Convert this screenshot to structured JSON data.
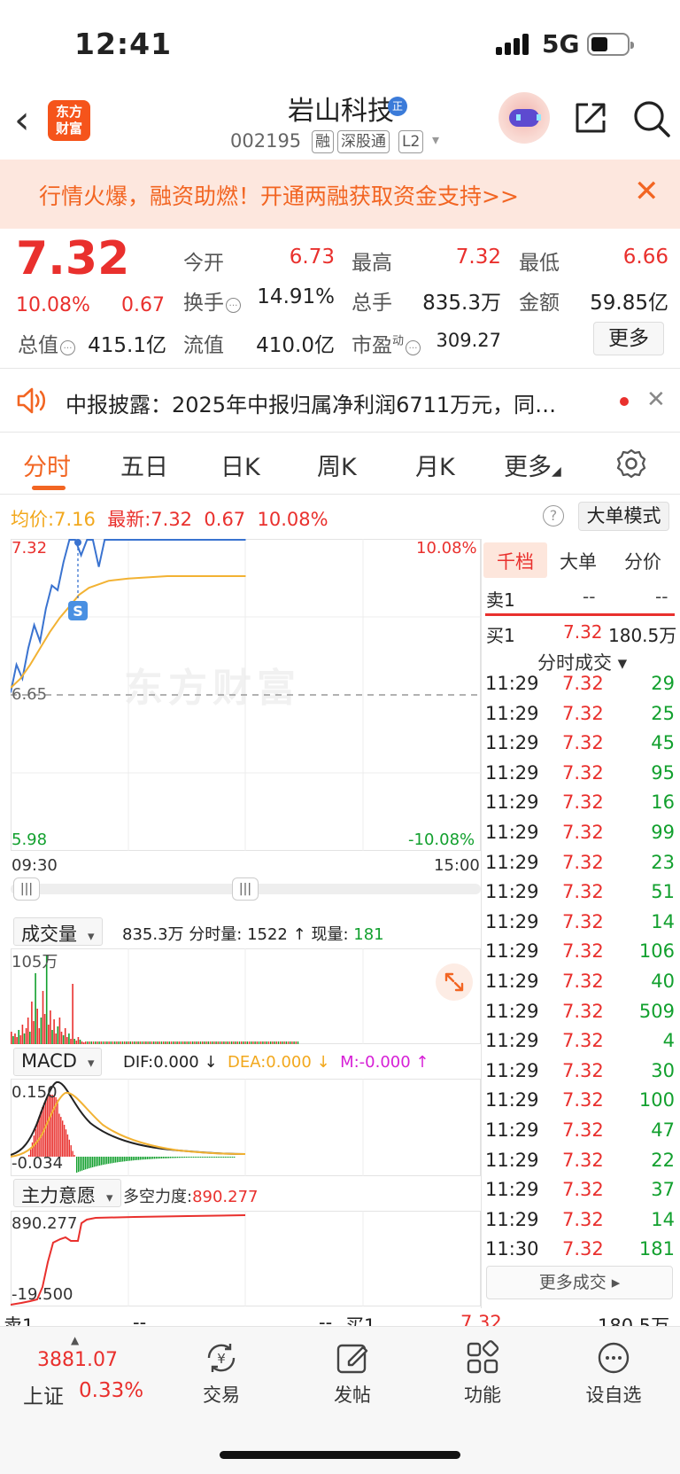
{
  "status_bar": {
    "time": "12:41",
    "network": "5G"
  },
  "header": {
    "stock_name": "岩山科技",
    "badge": "正",
    "code": "002195",
    "tags": [
      "融",
      "深股通",
      "L2"
    ],
    "logo_text": "东方财富",
    "icons": [
      "back-icon",
      "robot-avatar-icon",
      "share-icon",
      "search-icon"
    ]
  },
  "promo": {
    "text": "行情火爆，融资助燃！开通两融获取资金支持>>",
    "close": "✕"
  },
  "quote": {
    "price": "7.32",
    "change_pct": "10.08%",
    "change": "0.67",
    "open_label": "今开",
    "open": "6.73",
    "high_label": "最高",
    "high": "7.32",
    "low_label": "最低",
    "low": "6.66",
    "turnover_label": "换手",
    "turnover": "14.91%",
    "volume_label": "总手",
    "volume": "835.3万",
    "amount_label": "金额",
    "amount": "59.85亿",
    "mcap_label": "总值",
    "mcap": "415.1亿",
    "float_label": "流值",
    "float": "410.0亿",
    "pe_label": "市盈",
    "pe_sup": "动",
    "pe": "309.27",
    "more": "更多"
  },
  "news": {
    "text": "中报披露：2025年中报归属净利润6711万元，同…",
    "close": "✕"
  },
  "tabs": {
    "items": [
      "分时",
      "五日",
      "日K",
      "周K",
      "月K",
      "更多"
    ],
    "active": 0
  },
  "chart_info": {
    "avg_label": "均价:",
    "avg": "7.16",
    "latest_label": "最新:",
    "latest": "7.32",
    "chg": "0.67",
    "pct": "10.08%",
    "big_mode": "大单模式",
    "help": "?"
  },
  "chart": {
    "y_top": "7.32",
    "y_mid": "6.65",
    "y_bottom": "5.98",
    "pct_top": "10.08%",
    "pct_bottom": "-10.08%",
    "x_start": "09:30",
    "x_end": "15:00",
    "watermark": "东方财富",
    "marker": "S"
  },
  "volume_panel": {
    "selector": "成交量",
    "total": "835.3万",
    "minute_label": "分时量:",
    "minute": "1522",
    "arrow": "↑",
    "now_label": "现量:",
    "now": "181",
    "scale": "105万"
  },
  "macd_panel": {
    "selector": "MACD",
    "dif": "DIF:0.000 ↓",
    "dea": "DEA:0.000 ↓",
    "m": "M:-0.000 ↑",
    "top": "0.150",
    "bottom": "-0.034"
  },
  "force_panel": {
    "selector": "主力意愿",
    "label": "多空力度:",
    "value": "890.277",
    "top": "890.277",
    "bottom": "-19.500"
  },
  "right_panel": {
    "tabs": [
      "千档",
      "大单",
      "分价"
    ],
    "sell1": {
      "label": "卖1",
      "price": "--",
      "vol": "--"
    },
    "buy1": {
      "label": "买1",
      "price": "7.32",
      "vol": "180.5万"
    },
    "ticks_header": "分时成交 ▾",
    "ticks": [
      {
        "t": "11:29",
        "p": "7.32",
        "v": "29"
      },
      {
        "t": "11:29",
        "p": "7.32",
        "v": "25"
      },
      {
        "t": "11:29",
        "p": "7.32",
        "v": "45"
      },
      {
        "t": "11:29",
        "p": "7.32",
        "v": "95"
      },
      {
        "t": "11:29",
        "p": "7.32",
        "v": "16"
      },
      {
        "t": "11:29",
        "p": "7.32",
        "v": "99"
      },
      {
        "t": "11:29",
        "p": "7.32",
        "v": "23"
      },
      {
        "t": "11:29",
        "p": "7.32",
        "v": "51"
      },
      {
        "t": "11:29",
        "p": "7.32",
        "v": "14"
      },
      {
        "t": "11:29",
        "p": "7.32",
        "v": "106"
      },
      {
        "t": "11:29",
        "p": "7.32",
        "v": "40"
      },
      {
        "t": "11:29",
        "p": "7.32",
        "v": "509"
      },
      {
        "t": "11:29",
        "p": "7.32",
        "v": "4"
      },
      {
        "t": "11:29",
        "p": "7.32",
        "v": "30"
      },
      {
        "t": "11:29",
        "p": "7.32",
        "v": "100"
      },
      {
        "t": "11:29",
        "p": "7.32",
        "v": "47"
      },
      {
        "t": "11:29",
        "p": "7.32",
        "v": "22"
      },
      {
        "t": "11:29",
        "p": "7.32",
        "v": "37"
      },
      {
        "t": "11:29",
        "p": "7.32",
        "v": "14"
      },
      {
        "t": "11:30",
        "p": "7.32",
        "v": "181"
      }
    ],
    "more": "更多成交 ▸"
  },
  "bottom_row": {
    "sell_label": "卖1",
    "sell_price": "--",
    "sell_vol": "--",
    "buy_label": "买1",
    "buy_price": "7.32",
    "buy_vol": "180.5万"
  },
  "bottom_nav": {
    "index_value": "3881.07",
    "index_name": "上证",
    "index_pct": "0.33%",
    "items": [
      "交易",
      "发帖",
      "功能",
      "设自选"
    ]
  },
  "colors": {
    "up": "#e9302d",
    "down": "#12a02e",
    "accent": "#f26522",
    "price_line": "#3a73d0",
    "avg_line": "#f2b233"
  },
  "chart_data": {
    "type": "line",
    "x_range": [
      "09:30",
      "15:00"
    ],
    "y_range": [
      5.98,
      7.32
    ],
    "prev_close": 6.65,
    "series": [
      {
        "name": "最新",
        "color": "#3a73d0",
        "x_minutes": [
          0,
          3,
          6,
          9,
          12,
          15,
          18,
          21,
          24,
          27,
          30,
          33,
          36,
          39,
          42,
          45,
          48,
          51,
          54,
          57,
          60,
          75,
          90,
          105,
          120
        ],
        "values": [
          6.66,
          6.78,
          6.72,
          6.85,
          6.95,
          6.88,
          7.02,
          7.12,
          7.1,
          7.22,
          7.32,
          7.32,
          7.25,
          7.32,
          7.32,
          7.2,
          7.32,
          7.32,
          7.32,
          7.32,
          7.32,
          7.32,
          7.32,
          7.32,
          7.32
        ]
      },
      {
        "name": "均价",
        "color": "#f2b233",
        "x_minutes": [
          0,
          5,
          10,
          15,
          20,
          25,
          30,
          35,
          40,
          50,
          60,
          80,
          100,
          120
        ],
        "values": [
          6.68,
          6.72,
          6.78,
          6.85,
          6.92,
          6.98,
          7.03,
          7.08,
          7.11,
          7.14,
          7.15,
          7.16,
          7.16,
          7.16
        ]
      }
    ]
  }
}
